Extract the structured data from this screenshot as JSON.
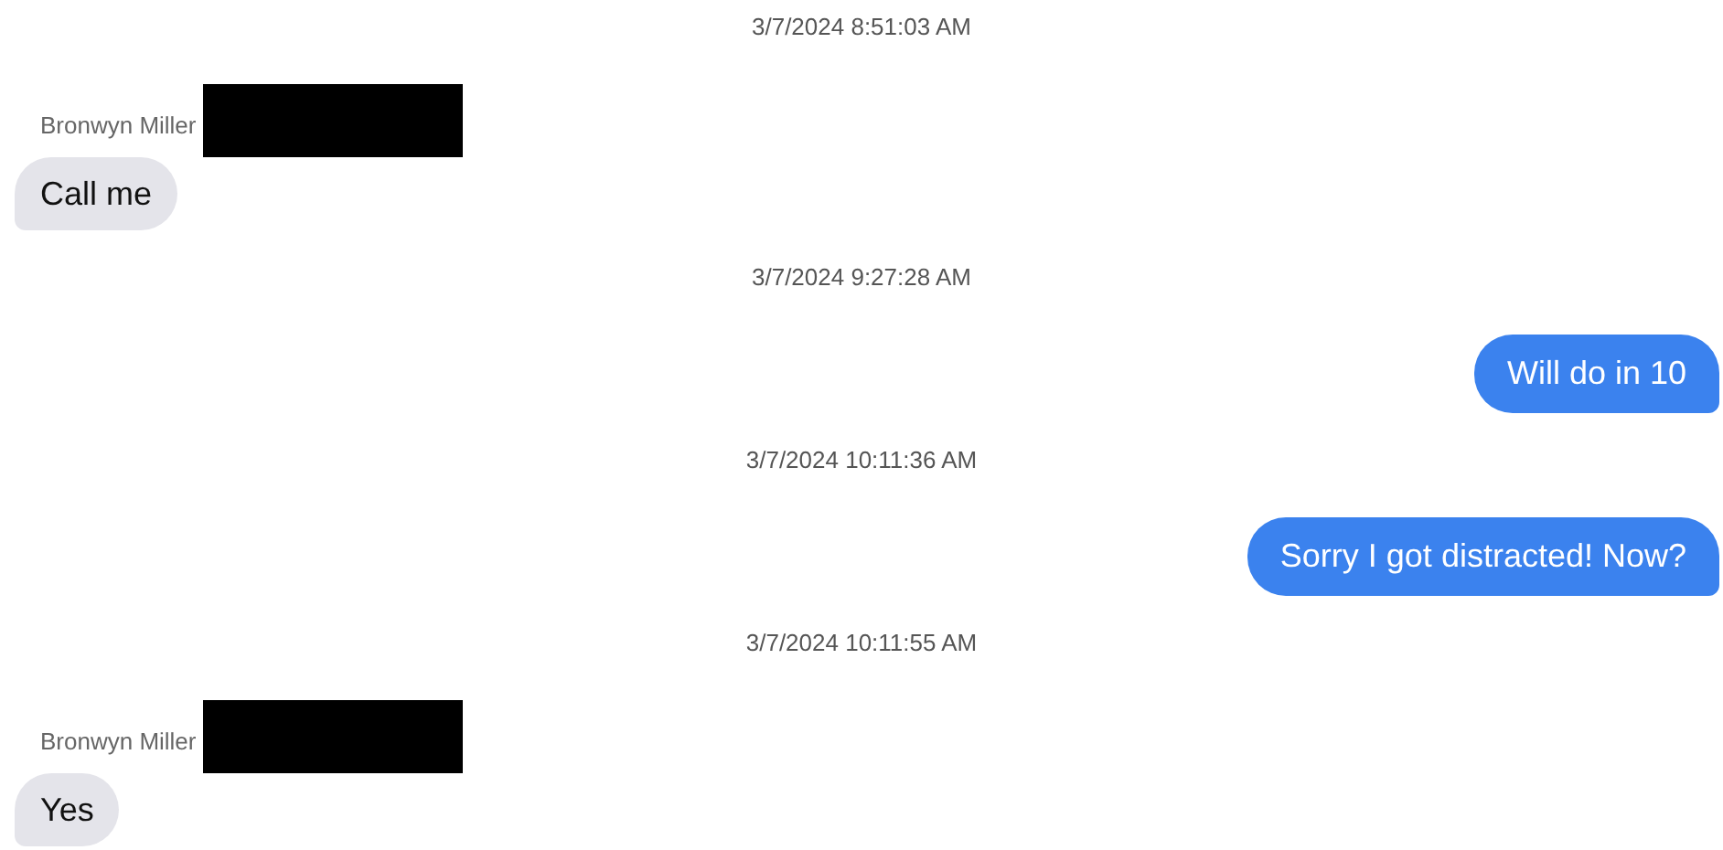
{
  "messages": [
    {
      "kind": "timestamp",
      "text": "3/7/2024 8:51:03 AM"
    },
    {
      "kind": "incoming",
      "sender": "Bronwyn Miller",
      "redacted": true,
      "text": "Call me"
    },
    {
      "kind": "timestamp",
      "text": "3/7/2024 9:27:28 AM"
    },
    {
      "kind": "outgoing",
      "text": "Will do in 10"
    },
    {
      "kind": "timestamp",
      "text": "3/7/2024 10:11:36 AM"
    },
    {
      "kind": "outgoing",
      "text": "Sorry I got distracted! Now?"
    },
    {
      "kind": "timestamp",
      "text": "3/7/2024 10:11:55 AM"
    },
    {
      "kind": "incoming",
      "sender": "Bronwyn Miller",
      "redacted": true,
      "text": "Yes"
    }
  ]
}
